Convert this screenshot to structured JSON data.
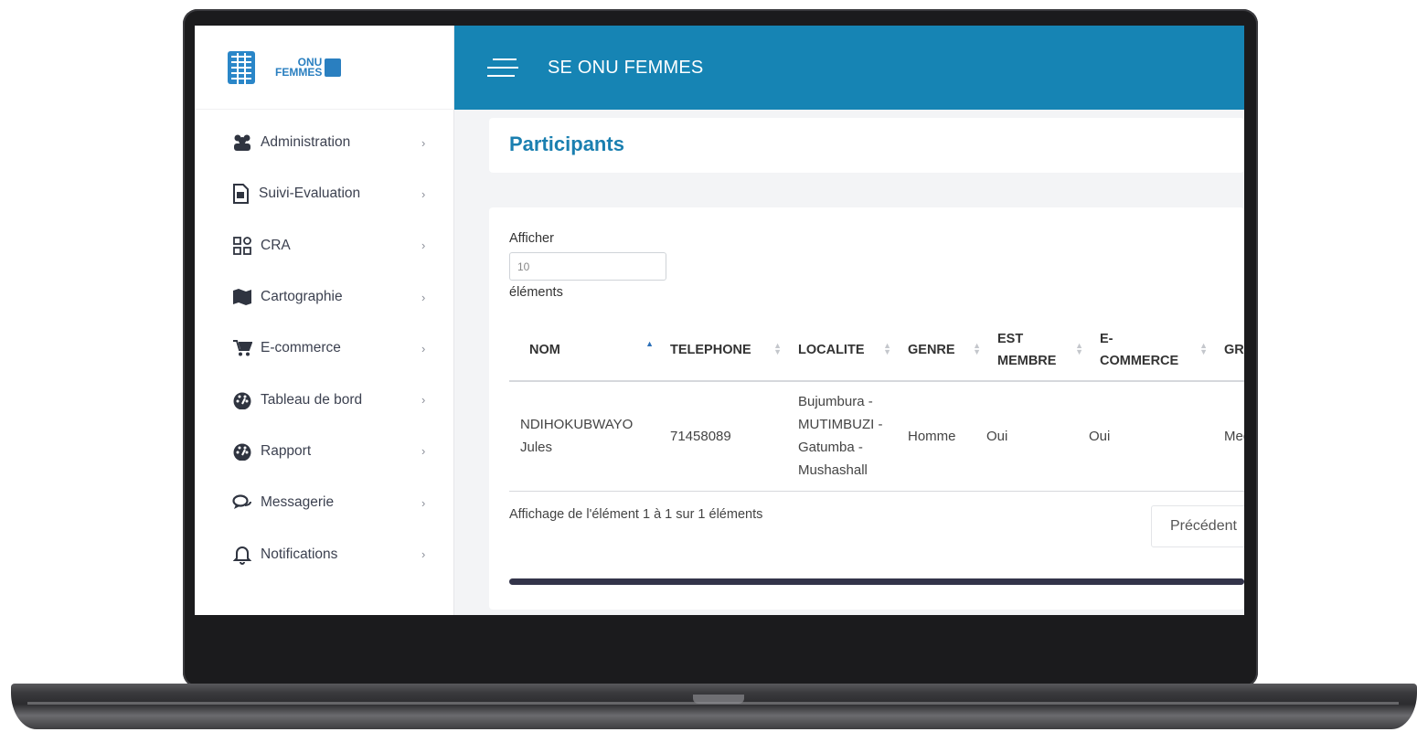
{
  "app": {
    "title": "SE ONU FEMMES",
    "brand_text_top": "ONU",
    "brand_text_bottom": "FEMMES"
  },
  "sidebar": {
    "items": [
      {
        "label": "Administration",
        "icon": "users-icon"
      },
      {
        "label": "Suivi-Evaluation",
        "icon": "document-icon"
      },
      {
        "label": "CRA",
        "icon": "grid-icon"
      },
      {
        "label": "Cartographie",
        "icon": "map-icon"
      },
      {
        "label": "E-commerce",
        "icon": "cart-icon"
      },
      {
        "label": "Tableau de bord",
        "icon": "dashboard-icon"
      },
      {
        "label": "Rapport",
        "icon": "dashboard-icon"
      },
      {
        "label": "Messagerie",
        "icon": "chat-icon"
      },
      {
        "label": "Notifications",
        "icon": "bell-icon"
      }
    ]
  },
  "page": {
    "title": "Participants"
  },
  "table_controls": {
    "show_label": "Afficher",
    "page_length": "10",
    "show_suffix": "éléments"
  },
  "table": {
    "columns": [
      "NOM",
      "TELEPHONE",
      "LOCALITE",
      "GENRE",
      "EST MEMBRE",
      "E-COMMERCE",
      "GR"
    ],
    "rows": [
      {
        "nom": "NDIHOKUBWAYO Jules",
        "telephone": "71458089",
        "localite": "Bujumbura - MUTIMBUZI - Gatumba - Mushashall",
        "genre": "Homme",
        "est_membre": "Oui",
        "e_commerce": "Oui",
        "gr": "Med"
      }
    ]
  },
  "footer": {
    "info": "Affichage de l'élément 1 à 1 sur 1 éléments",
    "prev_label": "Précédent"
  },
  "colors": {
    "topbar": "#1684b4",
    "title_blue": "#1a7fb0",
    "sidebar_text": "#3c4150"
  }
}
